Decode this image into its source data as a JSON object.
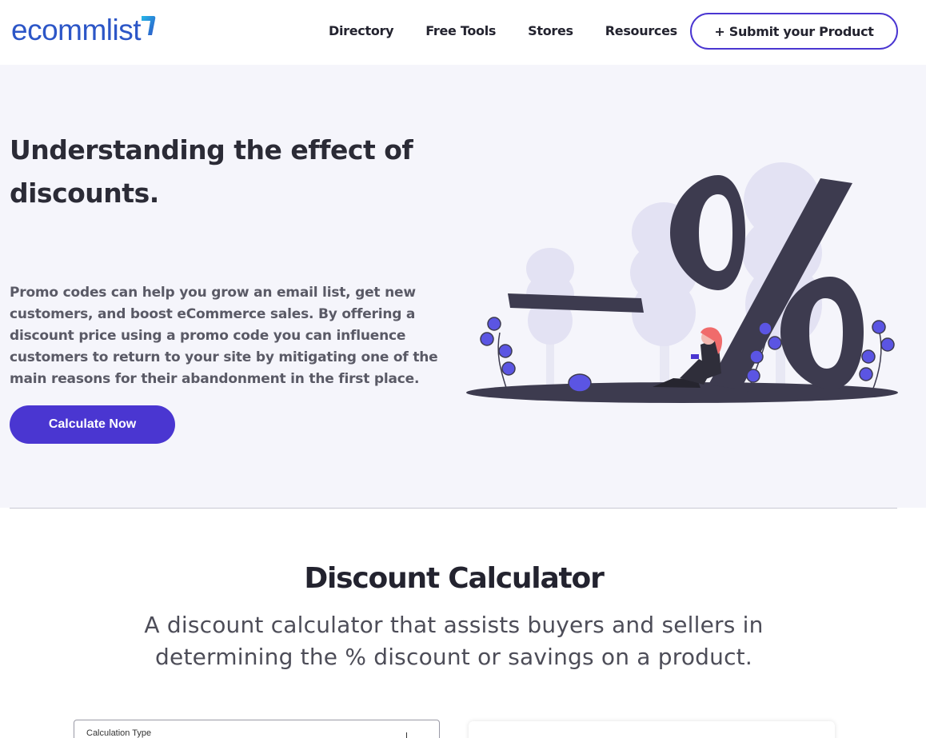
{
  "header": {
    "logo_text": "ecommlist",
    "nav": [
      "Directory",
      "Free Tools",
      "Stores",
      "Resources"
    ],
    "submit_label": "+ Submit your Product"
  },
  "hero": {
    "title": "Understanding the effect of discounts.",
    "description": "Promo codes can help you grow an email list, get new customers, and boost eCommerce sales. By offering a discount price using a promo code you can influence customers to return to your site by mitigating one of the main reasons for their abandonment in the first place.",
    "cta_label": "Calculate Now",
    "illustration_icon": "discount-percent-illustration"
  },
  "calculator": {
    "title": "Discount Calculator",
    "subtitle": "A discount calculator that assists buyers and sellers in determining the % discount or savings on a product.",
    "field_label": "Calculation Type"
  },
  "colors": {
    "brand_blue": "#2c56c7",
    "accent_purple": "#4a36d1",
    "hero_bg": "#f5f5fb",
    "illustration_dark": "#3d3b4f",
    "illustration_light": "#e3e2f3"
  }
}
